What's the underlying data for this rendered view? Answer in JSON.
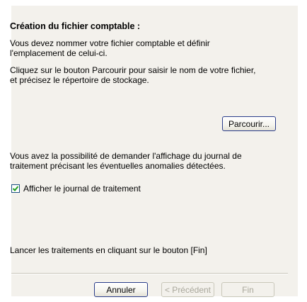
{
  "title": "Création du fichier comptable :",
  "intro_text": "Vous devez nommer votre fichier comptable et définir\nl'emplacement de celui-ci.",
  "browse_text": "Cliquez sur le bouton Parcourir pour saisir le nom de votre fichier,\net précisez le répertoire de stockage.",
  "browse_button": "Parcourir...",
  "journal_text": "Vous avez la possibilité de demander l'affichage du journal de\ntraitement précisant les éventuelles anomalies détectées.",
  "journal_checkbox": {
    "label": "Afficher le journal de traitement",
    "checked": true
  },
  "finish_text": "Lancer les traitements en cliquant sur le bouton [Fin]",
  "buttons": {
    "cancel": "Annuler",
    "previous": "< Précédent",
    "finish": "Fin"
  },
  "colors": {
    "panel": "#f3f1ec",
    "button_border": "#2a3d8a",
    "check": "#21a121"
  }
}
